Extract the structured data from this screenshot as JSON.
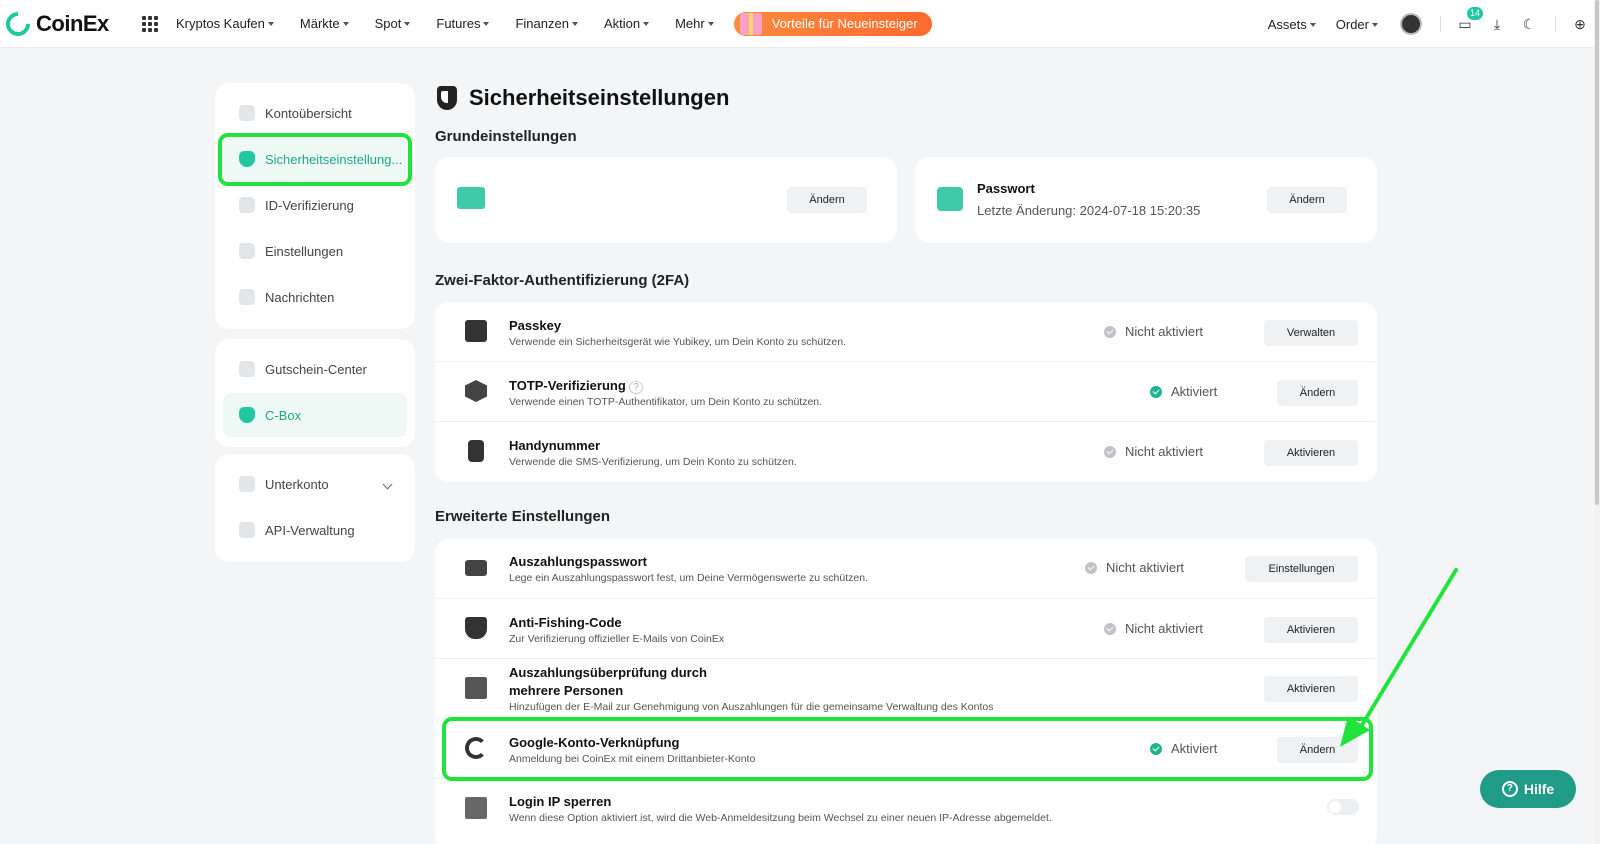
{
  "brand": {
    "name": "CoinEx",
    "accent": "#1fc8a1",
    "highlight": "#22e33b"
  },
  "nav": {
    "items": [
      "Kryptos Kaufen",
      "Märkte",
      "Spot",
      "Futures",
      "Finanzen",
      "Aktion",
      "Mehr"
    ],
    "promo": "Vorteile für Neueinsteiger",
    "right": {
      "assets": "Assets",
      "order": "Order",
      "messages_count": "14"
    }
  },
  "sidebar": {
    "group1": [
      "Kontoübersicht",
      "Sicherheitseinstellung...",
      "ID-Verifizierung",
      "Einstellungen",
      "Nachrichten"
    ],
    "group2": [
      "Gutschein-Center",
      "C-Box"
    ],
    "group3": [
      "Unterkonto",
      "API-Verwaltung"
    ]
  },
  "page": {
    "title": "Sicherheitseinstellungen"
  },
  "basic": {
    "heading": "Grundeinstellungen",
    "email": {
      "button": "Ändern"
    },
    "password": {
      "title": "Passwort",
      "desc": "Letzte Änderung: 2024-07-18 15:20:35",
      "button": "Ändern"
    }
  },
  "twofa": {
    "heading": "Zwei-Faktor-Authentifizierung (2FA)",
    "rows": [
      {
        "title": "Passkey",
        "desc": "Verwende ein Sicherheitsgerät wie Yubikey, um Dein Konto zu schützen.",
        "status": "Nicht aktiviert",
        "button": "Verwalten"
      },
      {
        "title": "TOTP-Verifizierung",
        "desc": "Verwende einen TOTP-Authentifikator, um Dein Konto zu schützen.",
        "status": "Aktiviert",
        "button": "Ändern"
      },
      {
        "title": "Handynummer",
        "desc": "Verwende die SMS-Verifizierung, um Dein Konto zu schützen.",
        "status": "Nicht aktiviert",
        "button": "Aktivieren"
      }
    ]
  },
  "advanced": {
    "heading": "Erweiterte Einstellungen",
    "rows": [
      {
        "title": "Auszahlungspasswort",
        "desc": "Lege ein Auszahlungspasswort fest, um Deine Vermögenswerte zu schützen.",
        "status": "Nicht aktiviert",
        "button": "Einstellungen"
      },
      {
        "title": "Anti-Fishing-Code",
        "desc": "Zur Verifizierung offizieller E-Mails von CoinEx",
        "status": "Nicht aktiviert",
        "button": "Aktivieren"
      },
      {
        "title": "Auszahlungsüberprüfung durch",
        "title2": "mehrere Personen",
        "desc": "Hinzufügen der E-Mail zur Genehmigung von Auszahlungen für die gemeinsame Verwaltung des Kontos",
        "button": "Aktivieren"
      },
      {
        "title": "Google-Konto-Verknüpfung",
        "desc": "Anmeldung bei CoinEx mit einem Drittanbieter-Konto",
        "status": "Aktiviert",
        "button": "Ändern"
      },
      {
        "title": "Login IP sperren",
        "desc": "Wenn diese Option aktiviert ist, wird die Web-Anmeldesitzung beim Wechsel zu einer neuen IP-Adresse abgemeldet."
      }
    ]
  },
  "help": {
    "label": "Hilfe"
  }
}
